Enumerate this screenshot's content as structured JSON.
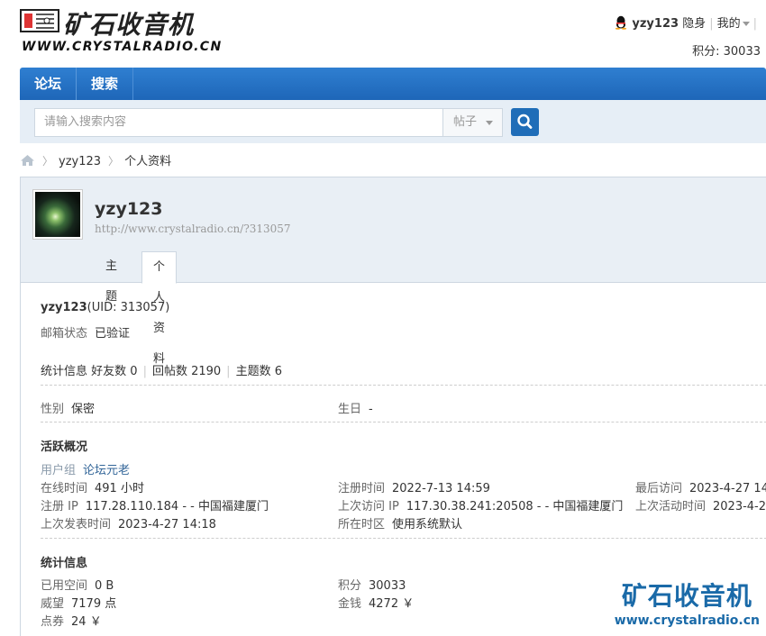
{
  "site": {
    "logo_cn": "矿石收音机",
    "logo_url": "WWW.CRYSTALRADIO.CN"
  },
  "usernav": {
    "username": "yzy123",
    "invisible": "隐身",
    "mine": "我的",
    "credits": "积分: 30033"
  },
  "nav": {
    "forum": "论坛",
    "search": "搜索"
  },
  "search": {
    "placeholder": "请输入搜索内容",
    "type": "帖子"
  },
  "breadcrumb": {
    "user": "yzy123",
    "page": "个人资料"
  },
  "profile": {
    "name": "yzy123",
    "url": "http://www.crystalradio.cn/?313057",
    "tabs": [
      "主题",
      "个人资料"
    ],
    "uid_name": "yzy123",
    "uid": "(UID: 313057)",
    "email_label": "邮箱状态",
    "email_value": "已验证",
    "stats_label": "统计信息",
    "friends": "好友数 0",
    "replies": "回帖数 2190",
    "threads": "主题数 6",
    "gender_label": "性别",
    "gender_value": "保密",
    "birthday_label": "生日",
    "birthday_value": "-"
  },
  "activity": {
    "title": "活跃概况",
    "usergroup_label": "用户组",
    "usergroup_value": "论坛元老",
    "online_label": "在线时间",
    "online_value": "491 小时",
    "reg_time_label": "注册时间",
    "reg_time_value": "2022-7-13 14:59",
    "last_visit_label": "最后访问",
    "last_visit_value": "2023-4-27 14:",
    "reg_ip_label": "注册 IP",
    "reg_ip_value": "117.28.110.184 - - 中国福建厦门",
    "last_ip_label": "上次访问 IP",
    "last_ip_value": "117.30.38.241:20508 - - 中国福建厦门",
    "last_active_label": "上次活动时间",
    "last_active_value": "2023-4-2",
    "last_post_label": "上次发表时间",
    "last_post_value": "2023-4-27 14:18",
    "timezone_label": "所在时区",
    "timezone_value": "使用系统默认"
  },
  "stats": {
    "title": "统计信息",
    "space_label": "已用空间",
    "space_value": "0 B",
    "credits_label": "积分",
    "credits_value": "30033",
    "prestige_label": "威望",
    "prestige_value": "7179 点",
    "money_label": "金钱",
    "money_value": "4272 ￥",
    "coupon_label": "点券",
    "coupon_value": "24 ￥"
  },
  "watermark": {
    "cn": "矿石收音机",
    "url": "www.crystalradio.cn"
  }
}
